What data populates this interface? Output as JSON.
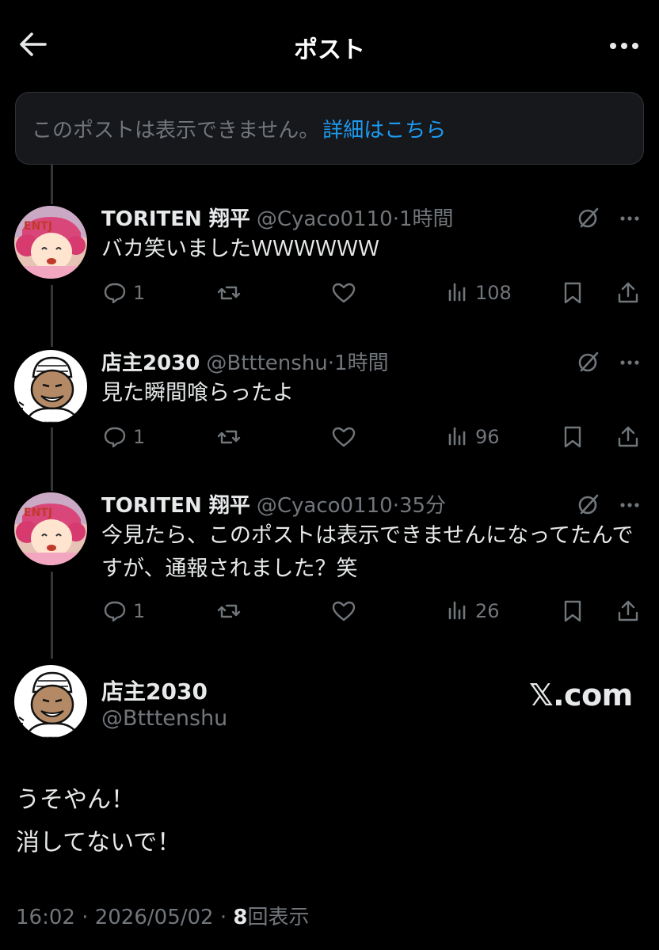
{
  "header": {
    "title": "ポスト",
    "back_icon": "arrow-left-icon",
    "more_icon": "more-horizontal-icon"
  },
  "notice": {
    "text": "このポストは表示できません。",
    "link": "詳細はこちら"
  },
  "replies": [
    {
      "name": "TORITEN 翔平",
      "handle": "@Cyaco0110",
      "time": "·1時間",
      "text": "バカ笑いましたＷＷＷＷＷＷ",
      "replies": "1",
      "views": "108",
      "avatar": "anime-character-avatar"
    },
    {
      "name": "店主2030",
      "handle": "@Btttenshu",
      "time": "·1時間",
      "text": "見た瞬間喰らったよ",
      "replies": "1",
      "views": "96",
      "avatar": "cartoon-man-avatar"
    },
    {
      "name": "TORITEN 翔平",
      "handle": "@Cyaco0110",
      "time": "·35分",
      "text": "今見たら、このポストは表示できませんになってたんですが、通報されました？笑",
      "replies": "1",
      "views": "26",
      "avatar": "anime-character-avatar"
    }
  ],
  "main_post": {
    "name": "店主2030",
    "handle": "@Btttenshu",
    "watermark": "𝕏.com",
    "line1": "うそやん！",
    "line2": "消してないで！",
    "timestamp": "16:02 · 2026/05/02 · ",
    "views_count": "8",
    "views_label": "回表示"
  },
  "colors": {
    "background": "#000000",
    "text": "#e7e9ea",
    "secondary": "#71767b",
    "link": "#1d9bf0",
    "notice_bg": "#16181c"
  }
}
